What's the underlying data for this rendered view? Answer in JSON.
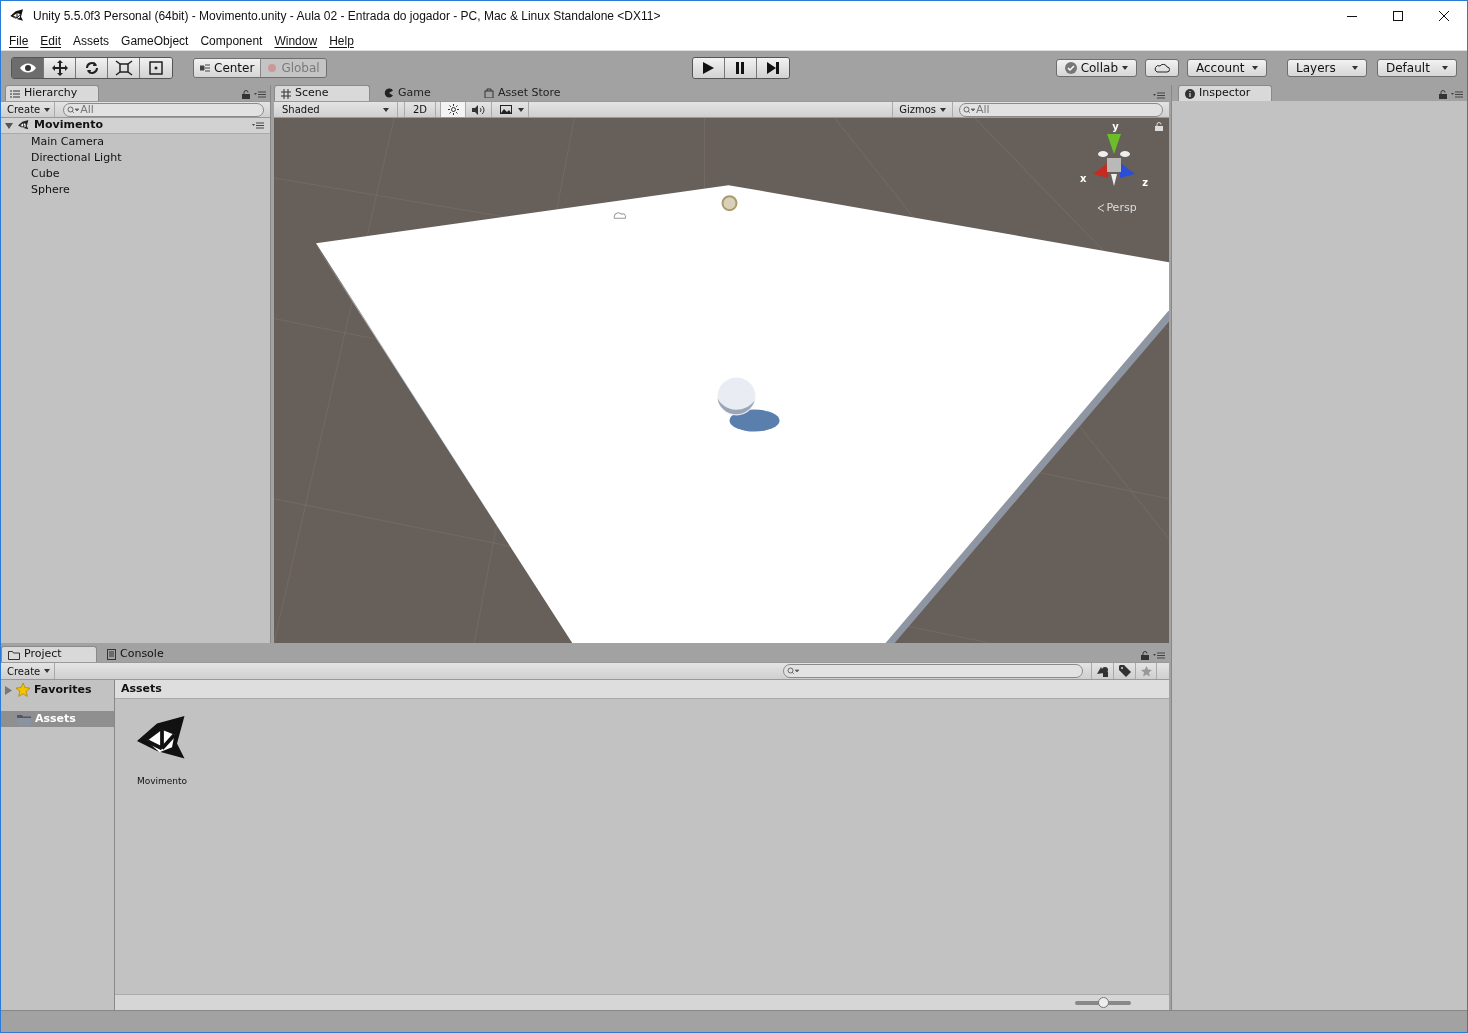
{
  "window": {
    "title": "Unity 5.5.0f3 Personal (64bit) - Movimento.unity - Aula 02 - Entrada do jogador - PC, Mac & Linux Standalone <DX11>"
  },
  "menu": [
    {
      "label": "File",
      "underlined": true
    },
    {
      "label": "Edit",
      "underlined": true
    },
    {
      "label": "Assets",
      "underlined": false
    },
    {
      "label": "GameObject",
      "underlined": false
    },
    {
      "label": "Component",
      "underlined": false
    },
    {
      "label": "Window",
      "underlined": true
    },
    {
      "label": "Help",
      "underlined": true
    }
  ],
  "toolbar": {
    "tools": [
      {
        "kind": "hand",
        "selected": true
      },
      {
        "kind": "move",
        "selected": false
      },
      {
        "kind": "rotate",
        "selected": false
      },
      {
        "kind": "scale",
        "selected": false
      },
      {
        "kind": "rect",
        "selected": false
      }
    ],
    "pivot": [
      {
        "label": "Center",
        "disabled": false
      },
      {
        "label": "Global",
        "disabled": true
      }
    ],
    "play": [
      {
        "kind": "play"
      },
      {
        "kind": "pause"
      },
      {
        "kind": "step"
      }
    ],
    "collab": "Collab",
    "account": "Account",
    "layers": "Layers",
    "layout": "Default"
  },
  "hierarchy": {
    "tab": "Hierarchy",
    "create": "Create",
    "search_placeholder": "All",
    "scene": "Movimento",
    "objects": [
      "Main Camera",
      "Directional Light",
      "Cube",
      "Sphere"
    ]
  },
  "scene_panel": {
    "tabs": [
      {
        "label": "Scene",
        "kind": "scene",
        "selected": true
      },
      {
        "label": "Game",
        "kind": "game",
        "selected": false
      },
      {
        "label": "Asset Store",
        "kind": "store",
        "selected": false
      }
    ],
    "shading": "Shaded",
    "mode_2d": "2D",
    "lighting_on": true,
    "audio_on": false,
    "gizmos": "Gizmos",
    "search_placeholder": "All",
    "axes": {
      "y": "y",
      "x": "x",
      "z": "z"
    },
    "projection": "Persp"
  },
  "project": {
    "tabs": [
      {
        "label": "Project",
        "kind": "project",
        "selected": true
      },
      {
        "label": "Console",
        "kind": "console",
        "selected": false
      }
    ],
    "create": "Create",
    "tree": [
      {
        "label": "Favorites",
        "kind": "favorites",
        "selected": false
      },
      {
        "label": "Assets",
        "kind": "folder",
        "selected": true
      }
    ],
    "breadcrumb": "Assets",
    "assets": [
      {
        "name": "Movimento"
      }
    ],
    "zoom": {
      "level": 0.5
    }
  },
  "inspector": {
    "tab": "Inspector"
  }
}
